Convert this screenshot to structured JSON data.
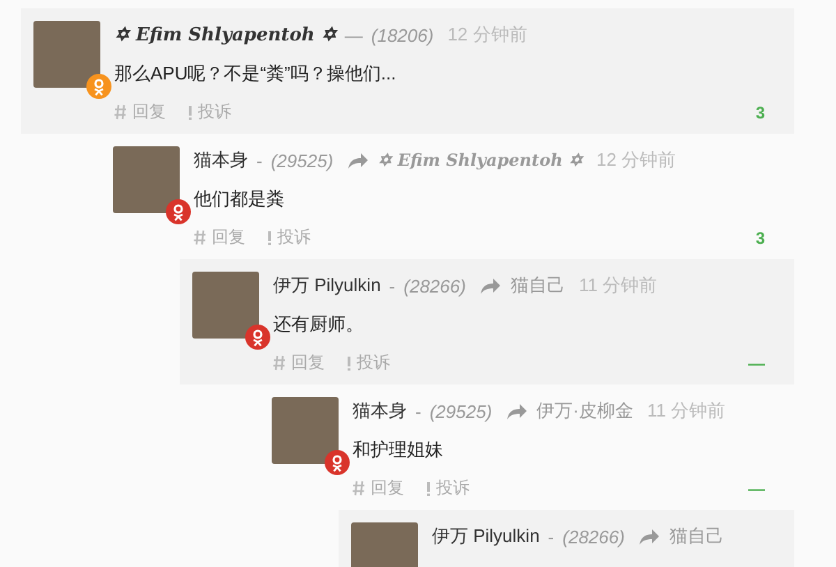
{
  "comments": [
    {
      "author": "✡ Efim Shlyapentoh ✡",
      "fancy_author": true,
      "separator": "—",
      "rating": "(18206)",
      "time": "12 分钟前",
      "color": "#f7931e",
      "body": "那么APU呢？不是“粪”吗？操他们...",
      "reply_label": "回复",
      "report_label": "投诉",
      "votes": "3",
      "children": [
        {
          "author": "猫本身",
          "fancy_author": false,
          "separator": "-",
          "rating": "(29525)",
          "reply_to": {
            "name": "✡ Efim Shlyapentoh ✡",
            "fancy": true
          },
          "time": "12 分钟前",
          "color": "#d9342b",
          "body": "他们都是粪",
          "reply_label": "回复",
          "report_label": "投诉",
          "votes": "3",
          "children": [
            {
              "author": "伊万 Pilyulkin",
              "fancy_author": false,
              "separator": "-",
              "rating": "(28266)",
              "reply_to": {
                "name": "猫自己",
                "fancy": false
              },
              "time": "11 分钟前",
              "color": "#d9342b",
              "body": "还有厨师。",
              "reply_label": "回复",
              "report_label": "投诉",
              "votes": "—",
              "children": [
                {
                  "author": "猫本身",
                  "fancy_author": false,
                  "separator": "-",
                  "rating": "(29525)",
                  "reply_to": {
                    "name": "伊万·皮柳金",
                    "fancy": false
                  },
                  "time": "11 分钟前",
                  "color": "#d9342b",
                  "body": "和护理姐妹",
                  "reply_label": "回复",
                  "report_label": "投诉",
                  "votes": "—",
                  "children": [
                    {
                      "author": "伊万 Pilyulkin",
                      "fancy_author": false,
                      "separator": "-",
                      "rating": "(28266)",
                      "reply_to": {
                        "name": "猫自己",
                        "fancy": false
                      }
                    }
                  ]
                }
              ]
            }
          ]
        }
      ]
    }
  ]
}
